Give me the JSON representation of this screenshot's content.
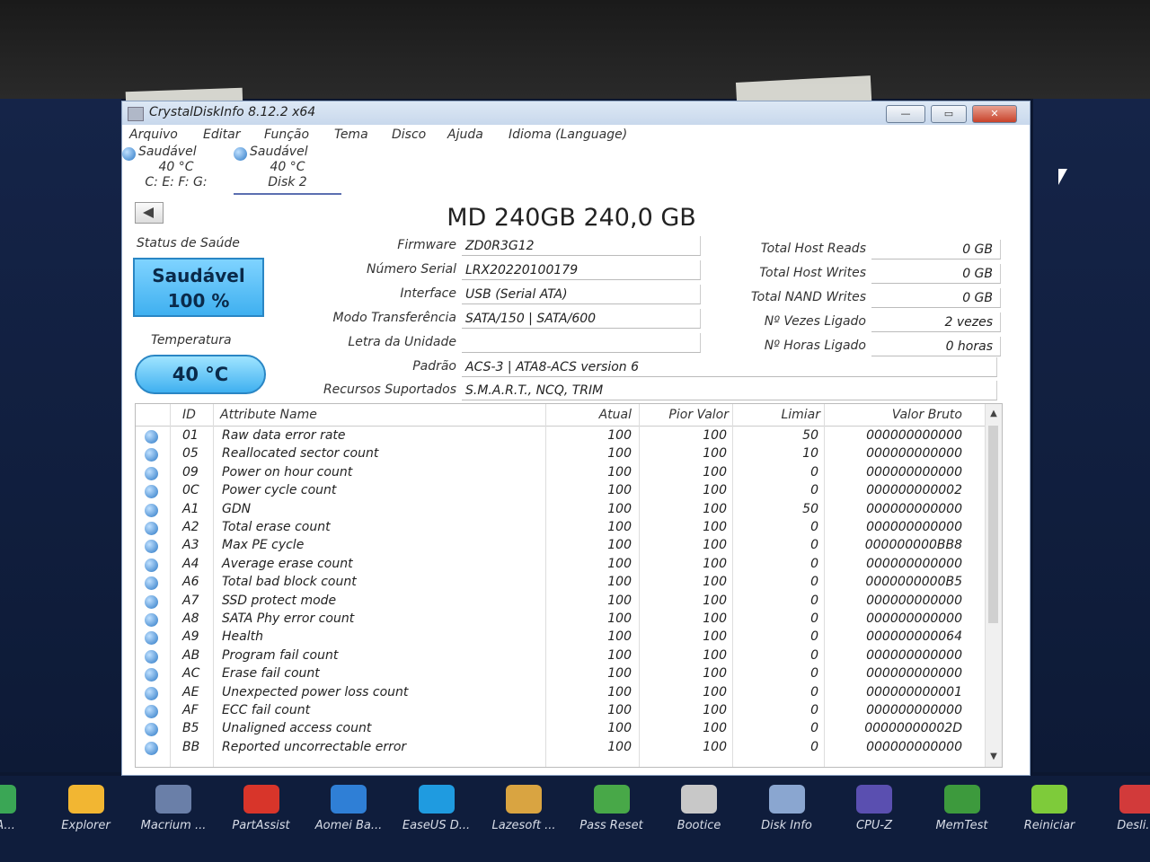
{
  "window": {
    "title": "CrystalDiskInfo 8.12.2 x64",
    "minimize": "—",
    "maximize": "▭",
    "close": "✕"
  },
  "menu": [
    "Arquivo",
    "Editar",
    "Função",
    "Tema",
    "Disco",
    "Ajuda",
    "Idioma (Language)"
  ],
  "disks": [
    {
      "status": "Saudável",
      "temp": "40 °C",
      "name": "C: E: F: G:"
    },
    {
      "status": "Saudável",
      "temp": "40 °C",
      "name": "Disk 2"
    }
  ],
  "model_title": "MD 240GB 240,0 GB",
  "health": {
    "label": "Status de Saúde",
    "status": "Saudável",
    "percent": "100 %",
    "temp_label": "Temperatura",
    "temp": "40 °C"
  },
  "info_left": [
    {
      "label": "Firmware",
      "value": "ZD0R3G12"
    },
    {
      "label": "Número Serial",
      "value": "LRX20220100179"
    },
    {
      "label": "Interface",
      "value": "USB (Serial ATA)"
    },
    {
      "label": "Modo Transferência",
      "value": "SATA/150 | SATA/600"
    },
    {
      "label": "Letra da Unidade",
      "value": ""
    }
  ],
  "info_wide": [
    {
      "label": "Padrão",
      "value": "ACS-3 | ATA8-ACS version 6"
    },
    {
      "label": "Recursos Suportados",
      "value": "S.M.A.R.T., NCQ, TRIM"
    }
  ],
  "info_right": [
    {
      "label": "Total Host Reads",
      "value": "0 GB"
    },
    {
      "label": "Total Host Writes",
      "value": "0 GB"
    },
    {
      "label": "Total NAND Writes",
      "value": "0 GB"
    },
    {
      "label": "Nº Vezes Ligado",
      "value": "2 vezes"
    },
    {
      "label": "Nº Horas Ligado",
      "value": "0 horas"
    }
  ],
  "smart": {
    "headers": {
      "id": "ID",
      "name": "Attribute Name",
      "current": "Atual",
      "worst": "Pior Valor",
      "threshold": "Limiar",
      "raw": "Valor Bruto"
    },
    "rows": [
      {
        "id": "01",
        "name": "Raw data error rate",
        "current": "100",
        "worst": "100",
        "threshold": "50",
        "raw": "000000000000"
      },
      {
        "id": "05",
        "name": "Reallocated sector count",
        "current": "100",
        "worst": "100",
        "threshold": "10",
        "raw": "000000000000"
      },
      {
        "id": "09",
        "name": "Power on hour count",
        "current": "100",
        "worst": "100",
        "threshold": "0",
        "raw": "000000000000"
      },
      {
        "id": "0C",
        "name": "Power cycle count",
        "current": "100",
        "worst": "100",
        "threshold": "0",
        "raw": "000000000002"
      },
      {
        "id": "A1",
        "name": "GDN",
        "current": "100",
        "worst": "100",
        "threshold": "50",
        "raw": "000000000000"
      },
      {
        "id": "A2",
        "name": "Total erase count",
        "current": "100",
        "worst": "100",
        "threshold": "0",
        "raw": "000000000000"
      },
      {
        "id": "A3",
        "name": "Max PE cycle",
        "current": "100",
        "worst": "100",
        "threshold": "0",
        "raw": "000000000BB8"
      },
      {
        "id": "A4",
        "name": "Average erase count",
        "current": "100",
        "worst": "100",
        "threshold": "0",
        "raw": "000000000000"
      },
      {
        "id": "A6",
        "name": "Total bad block count",
        "current": "100",
        "worst": "100",
        "threshold": "0",
        "raw": "0000000000B5"
      },
      {
        "id": "A7",
        "name": "SSD protect mode",
        "current": "100",
        "worst": "100",
        "threshold": "0",
        "raw": "000000000000"
      },
      {
        "id": "A8",
        "name": "SATA Phy error count",
        "current": "100",
        "worst": "100",
        "threshold": "0",
        "raw": "000000000000"
      },
      {
        "id": "A9",
        "name": "Health",
        "current": "100",
        "worst": "100",
        "threshold": "0",
        "raw": "000000000064"
      },
      {
        "id": "AB",
        "name": "Program fail count",
        "current": "100",
        "worst": "100",
        "threshold": "0",
        "raw": "000000000000"
      },
      {
        "id": "AC",
        "name": "Erase fail count",
        "current": "100",
        "worst": "100",
        "threshold": "0",
        "raw": "000000000000"
      },
      {
        "id": "AE",
        "name": "Unexpected power loss count",
        "current": "100",
        "worst": "100",
        "threshold": "0",
        "raw": "000000000001"
      },
      {
        "id": "AF",
        "name": "ECC fail count",
        "current": "100",
        "worst": "100",
        "threshold": "0",
        "raw": "000000000000"
      },
      {
        "id": "B5",
        "name": "Unaligned access count",
        "current": "100",
        "worst": "100",
        "threshold": "0",
        "raw": "00000000002D"
      },
      {
        "id": "BB",
        "name": "Reported uncorrectable error",
        "current": "100",
        "worst": "100",
        "threshold": "0",
        "raw": "000000000000"
      }
    ]
  },
  "taskbar": [
    {
      "label": "ALA...",
      "color": "#3aa655"
    },
    {
      "label": "Explorer",
      "color": "#f2b632"
    },
    {
      "label": "Macrium ...",
      "color": "#6a7fa8"
    },
    {
      "label": "PartAssist",
      "color": "#d8352a"
    },
    {
      "label": "Aomei Ba...",
      "color": "#2f7fd6"
    },
    {
      "label": "EaseUS D...",
      "color": "#1f9be0"
    },
    {
      "label": "Lazesoft ...",
      "color": "#d9a441"
    },
    {
      "label": "Pass Reset",
      "color": "#48a848"
    },
    {
      "label": "Bootice",
      "color": "#c8c8c8"
    },
    {
      "label": "Disk Info",
      "color": "#8aa6d0"
    },
    {
      "label": "CPU-Z",
      "color": "#5a4fb0"
    },
    {
      "label": "MemTest",
      "color": "#3d9a3d"
    },
    {
      "label": "Reiniciar",
      "color": "#7ecb3a"
    },
    {
      "label": "Desli...",
      "color": "#d23a3a"
    }
  ]
}
